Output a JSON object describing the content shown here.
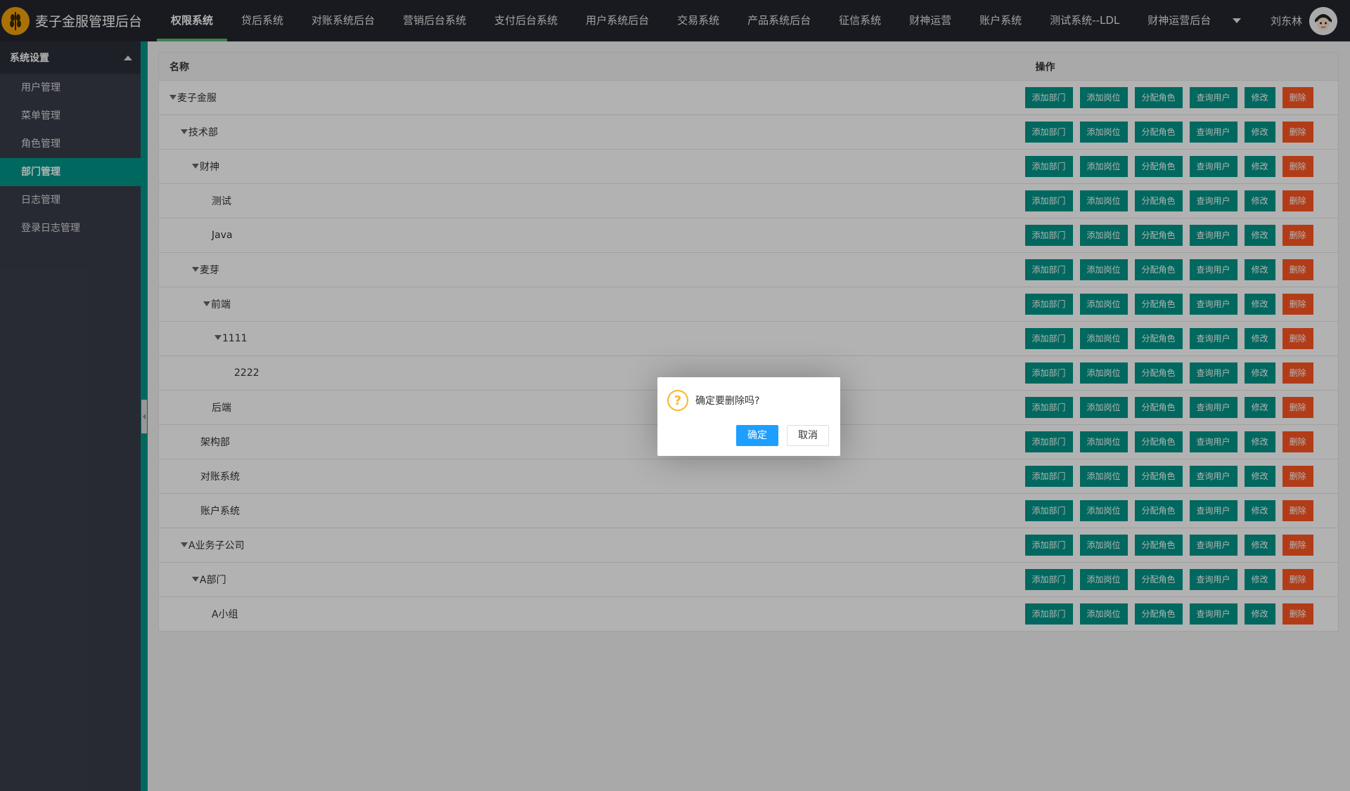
{
  "header": {
    "title": "麦子金服管理后台",
    "logo_icon": "wheat-logo-icon",
    "nav": [
      "权限系统",
      "贷后系统",
      "对账系统后台",
      "营销后台系统",
      "支付后台系统",
      "用户系统后台",
      "交易系统",
      "产品系统后台",
      "征信系统",
      "财神运营",
      "账户系统",
      "测试系统--LDL",
      "财神运营后台"
    ],
    "active_nav": "权限系统",
    "user_name": "刘东林",
    "accent_color": "#5fb878"
  },
  "sidebar": {
    "group": "系统设置",
    "items": [
      {
        "label": "用户管理"
      },
      {
        "label": "菜单管理"
      },
      {
        "label": "角色管理"
      },
      {
        "label": "部门管理",
        "active": true
      },
      {
        "label": "日志管理"
      },
      {
        "label": "登录日志管理"
      }
    ]
  },
  "table": {
    "headers": {
      "name": "名称",
      "ops": "操作"
    },
    "buttons": {
      "add_dept": "添加部门",
      "add_post": "添加岗位",
      "assign_role": "分配角色",
      "query_user": "查询用户",
      "edit": "修改",
      "delete": "删除"
    },
    "rows": [
      {
        "name": "麦子金服",
        "level": 0,
        "expanded": true
      },
      {
        "name": "技术部",
        "level": 1,
        "expanded": true
      },
      {
        "name": "财神",
        "level": 2,
        "expanded": true
      },
      {
        "name": "测试",
        "level": 3,
        "expanded": false
      },
      {
        "name": "Java",
        "level": 3,
        "expanded": false
      },
      {
        "name": "麦芽",
        "level": 2,
        "expanded": true
      },
      {
        "name": "前端",
        "level": 3,
        "expanded": true
      },
      {
        "name": "1111",
        "level": 4,
        "expanded": true
      },
      {
        "name": "2222",
        "level": 5,
        "expanded": false
      },
      {
        "name": "后端",
        "level": 3,
        "expanded": false
      },
      {
        "name": "架构部",
        "level": 2,
        "expanded": false
      },
      {
        "name": "对账系统",
        "level": 2,
        "expanded": false
      },
      {
        "name": "账户系统",
        "level": 2,
        "expanded": false
      },
      {
        "name": "A业务子公司",
        "level": 1,
        "expanded": true
      },
      {
        "name": "A部门",
        "level": 2,
        "expanded": true
      },
      {
        "name": "A小组",
        "level": 3,
        "expanded": false
      }
    ]
  },
  "dialog": {
    "icon": "question-icon",
    "message": "确定要删除吗?",
    "confirm": "确定",
    "cancel": "取消"
  },
  "colors": {
    "teal": "#009688",
    "danger": "#ff5722",
    "primary": "#1e9fff",
    "warn": "#f7b824"
  }
}
